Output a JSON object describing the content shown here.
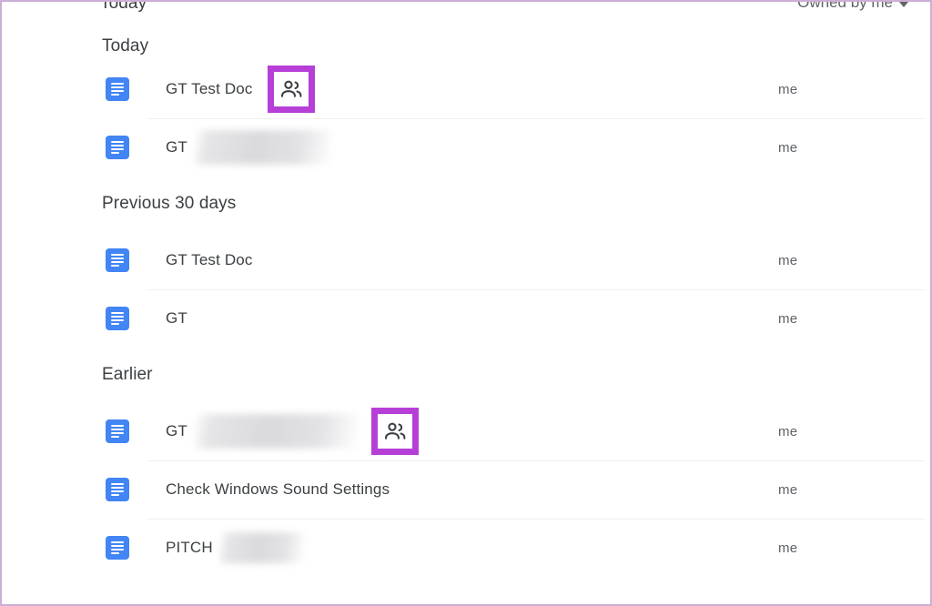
{
  "window": {
    "app": "Google Docs document list",
    "frame_color": "#cdaed6",
    "accent_highlight": "#b63fd8",
    "doc_icon_color": "#4285f4"
  },
  "top_bar": {
    "section_label": "Today",
    "owner_filter_label": "Owned by me",
    "owner_filter_caret": "chevron-down-icon"
  },
  "columns": {
    "owner_header": "Owned by me"
  },
  "groups": [
    {
      "id": "today",
      "label": "Today",
      "rows": [
        {
          "icon": "google-docs-icon",
          "title": "GT Test Doc",
          "redacted": false,
          "redacted_width": "",
          "shared": true,
          "shared_icon": "people-shared-icon",
          "highlighted": true,
          "owner": "me"
        },
        {
          "icon": "google-docs-icon",
          "title": "GT",
          "redacted": true,
          "redacted_width": "w-150",
          "shared": false,
          "shared_icon": "",
          "highlighted": false,
          "owner": "me"
        }
      ]
    },
    {
      "id": "previous-30-days",
      "label": "Previous 30 days",
      "rows": [
        {
          "icon": "google-docs-icon",
          "title": "GT Test Doc",
          "redacted": false,
          "redacted_width": "",
          "shared": false,
          "shared_icon": "",
          "highlighted": false,
          "owner": "me"
        },
        {
          "icon": "google-docs-icon",
          "title": "GT",
          "redacted": false,
          "redacted_width": "",
          "shared": false,
          "shared_icon": "",
          "highlighted": false,
          "owner": "me"
        }
      ]
    },
    {
      "id": "earlier",
      "label": "Earlier",
      "rows": [
        {
          "icon": "google-docs-icon",
          "title": "GT",
          "redacted": true,
          "redacted_width": "w-180",
          "shared": true,
          "shared_icon": "people-shared-icon",
          "highlighted": true,
          "owner": "me"
        },
        {
          "icon": "google-docs-icon",
          "title": "Check Windows Sound Settings",
          "redacted": false,
          "redacted_width": "",
          "shared": false,
          "shared_icon": "",
          "highlighted": false,
          "owner": "me"
        },
        {
          "icon": "google-docs-icon",
          "title": "PITCH",
          "redacted": true,
          "redacted_width": "w-92",
          "shared": false,
          "shared_icon": "",
          "highlighted": false,
          "owner": "me"
        }
      ]
    }
  ]
}
